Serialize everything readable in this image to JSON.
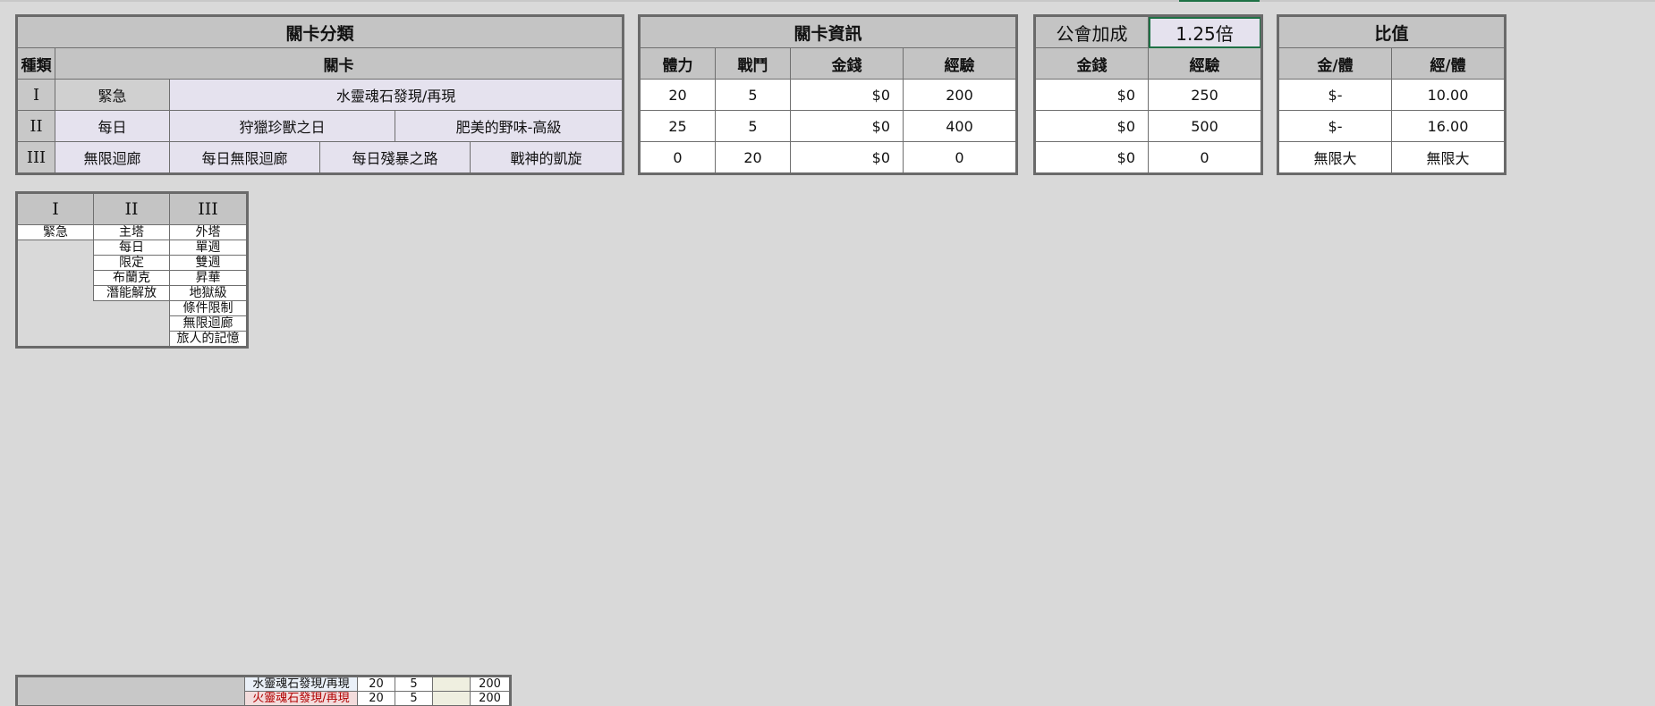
{
  "classification": {
    "title": "關卡分類",
    "col_type": "種類",
    "col_stage": "關卡",
    "rows": [
      {
        "roman": "I",
        "type": "緊急",
        "stages": [
          "水靈魂石發現/再現"
        ]
      },
      {
        "roman": "II",
        "type": "每日",
        "stages": [
          "狩獵珍獸之日",
          "肥美的野味-高級"
        ]
      },
      {
        "roman": "III",
        "type": "無限迴廊",
        "stages": [
          "每日無限迴廊",
          "每日殘暴之路",
          "戰神的凱旋"
        ]
      }
    ]
  },
  "stage_info": {
    "title": "關卡資訊",
    "headers": [
      "體力",
      "戰鬥",
      "金錢",
      "經驗"
    ],
    "rows": [
      [
        "20",
        "5",
        "$0",
        "200"
      ],
      [
        "25",
        "5",
        "$0",
        "400"
      ],
      [
        "0",
        "20",
        "$0",
        "0"
      ]
    ]
  },
  "guild_bonus": {
    "label": "公會加成",
    "value": "1.25倍",
    "headers": [
      "金錢",
      "經驗"
    ],
    "rows": [
      [
        "$0",
        "250"
      ],
      [
        "$0",
        "500"
      ],
      [
        "$0",
        "0"
      ]
    ]
  },
  "ratio": {
    "title": "比值",
    "headers": [
      "金/體",
      "經/體"
    ],
    "rows": [
      [
        "$-",
        "10.00"
      ],
      [
        "$-",
        "16.00"
      ],
      [
        "無限大",
        "無限大"
      ]
    ]
  },
  "legend": {
    "headers": [
      "I",
      "II",
      "III"
    ],
    "col1": [
      "緊急"
    ],
    "col2": [
      "主塔",
      "每日",
      "限定",
      "布蘭克",
      "潛能解放"
    ],
    "col3": [
      "外塔",
      "單週",
      "雙週",
      "昇華",
      "地獄級",
      "條件限制",
      "無限迴廊",
      "旅人的記憶"
    ]
  },
  "bottom_rows": [
    {
      "name": "水靈魂石發現/再現",
      "stamina": "20",
      "battle": "5",
      "money": "",
      "exp": "200"
    },
    {
      "name": "火靈魂石發現/再現",
      "stamina": "20",
      "battle": "5",
      "money": "",
      "exp": "200"
    }
  ]
}
